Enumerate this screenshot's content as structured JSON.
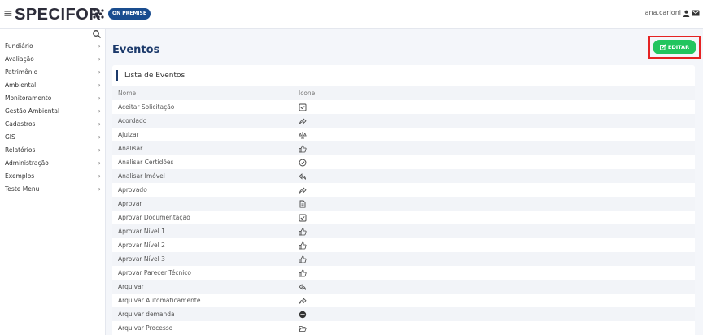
{
  "topbar": {
    "brand": "SPECIFOR",
    "badge": "ON PREMISE",
    "user": "ana.carioni"
  },
  "sidebar": {
    "items": [
      {
        "label": "Fundiário"
      },
      {
        "label": "Avaliação"
      },
      {
        "label": "Patrimônio"
      },
      {
        "label": "Ambiental"
      },
      {
        "label": "Monitoramento"
      },
      {
        "label": "Gestão Ambiental"
      },
      {
        "label": "Cadastros"
      },
      {
        "label": "GIS"
      },
      {
        "label": "Relatórios"
      },
      {
        "label": "Administração"
      },
      {
        "label": "Exemplos"
      },
      {
        "label": "Teste Menu"
      }
    ],
    "chevron": "›"
  },
  "main": {
    "title": "Eventos",
    "edit_label": "EDITAR",
    "card_title": "Lista de Eventos",
    "columns": [
      "Nome",
      "Icone"
    ],
    "rows": [
      {
        "name": "Aceitar Solicitação",
        "icon": "check-square-icon"
      },
      {
        "name": "Acordado",
        "icon": "share-icon"
      },
      {
        "name": "Ajuizar",
        "icon": "balance-scale-icon"
      },
      {
        "name": "Analisar",
        "icon": "thumbs-up-icon"
      },
      {
        "name": "Analisar Certidões",
        "icon": "check-circle-icon"
      },
      {
        "name": "Analisar Imóvel",
        "icon": "reply-icon"
      },
      {
        "name": "Aprovado",
        "icon": "share-icon"
      },
      {
        "name": "Aprovar",
        "icon": "file-text-icon"
      },
      {
        "name": "Aprovar Documentação",
        "icon": "check-square-icon"
      },
      {
        "name": "Aprovar Nível 1",
        "icon": "thumbs-up-icon"
      },
      {
        "name": "Aprovar Nível 2",
        "icon": "thumbs-up-icon"
      },
      {
        "name": "Aprovar Nível 3",
        "icon": "thumbs-up-icon"
      },
      {
        "name": "Aprovar Parecer Técnico",
        "icon": "thumbs-up-icon"
      },
      {
        "name": "Arquivar",
        "icon": "reply-icon"
      },
      {
        "name": "Arquivar Automaticamente.",
        "icon": "share-icon"
      },
      {
        "name": "Arquivar demanda",
        "icon": "minus-circle-icon"
      },
      {
        "name": "Arquivar Processo",
        "icon": "folder-open-icon"
      }
    ]
  },
  "colors": {
    "accent": "#1c3a6b",
    "edit_button": "#22c55e",
    "highlight_border": "#e52323",
    "badge": "#1a4d8f"
  }
}
